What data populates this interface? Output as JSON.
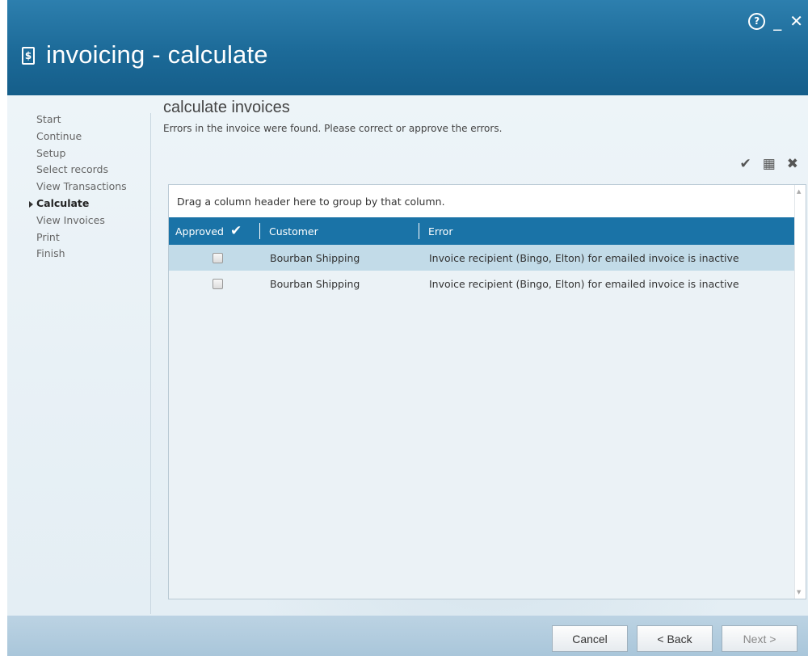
{
  "window": {
    "title": "invoicing - calculate",
    "icon": "invoice-document-icon",
    "controls": {
      "help": "?",
      "minimize": "_",
      "close": "✕"
    }
  },
  "nav": {
    "items": [
      {
        "label": "Start",
        "active": false
      },
      {
        "label": "Continue",
        "active": false
      },
      {
        "label": "Setup",
        "active": false
      },
      {
        "label": "Select records",
        "active": false
      },
      {
        "label": "View Transactions",
        "active": false
      },
      {
        "label": "Calculate",
        "active": true
      },
      {
        "label": "View Invoices",
        "active": false
      },
      {
        "label": "Print",
        "active": false
      },
      {
        "label": "Finish",
        "active": false
      }
    ]
  },
  "main": {
    "heading": "calculate invoices",
    "subtitle": "Errors in the invoice were found.  Please correct or approve the errors.",
    "toolbar": {
      "approve_icon": "checkmark-icon",
      "grid_icon": "grid-settings-icon",
      "close_icon": "close-icon"
    }
  },
  "grid": {
    "group_panel_text": "Drag a column header here to group by that column.",
    "columns": {
      "approved": "Approved",
      "customer": "Customer",
      "error": "Error"
    },
    "rows": [
      {
        "approved": false,
        "customer": "Bourban Shipping",
        "error": "Invoice recipient (Bingo, Elton) for emailed invoice is inactive"
      },
      {
        "approved": false,
        "customer": "Bourban Shipping",
        "error": "Invoice recipient (Bingo, Elton) for emailed invoice is inactive"
      }
    ]
  },
  "footer": {
    "cancel_label": "Cancel",
    "back_label": "< Back",
    "next_label": "Next >"
  },
  "colors": {
    "titlebar": "#1c6a98",
    "grid_header": "#1a73a7",
    "selected_row": "#c2dbe8",
    "footer": "#b3cde0"
  }
}
